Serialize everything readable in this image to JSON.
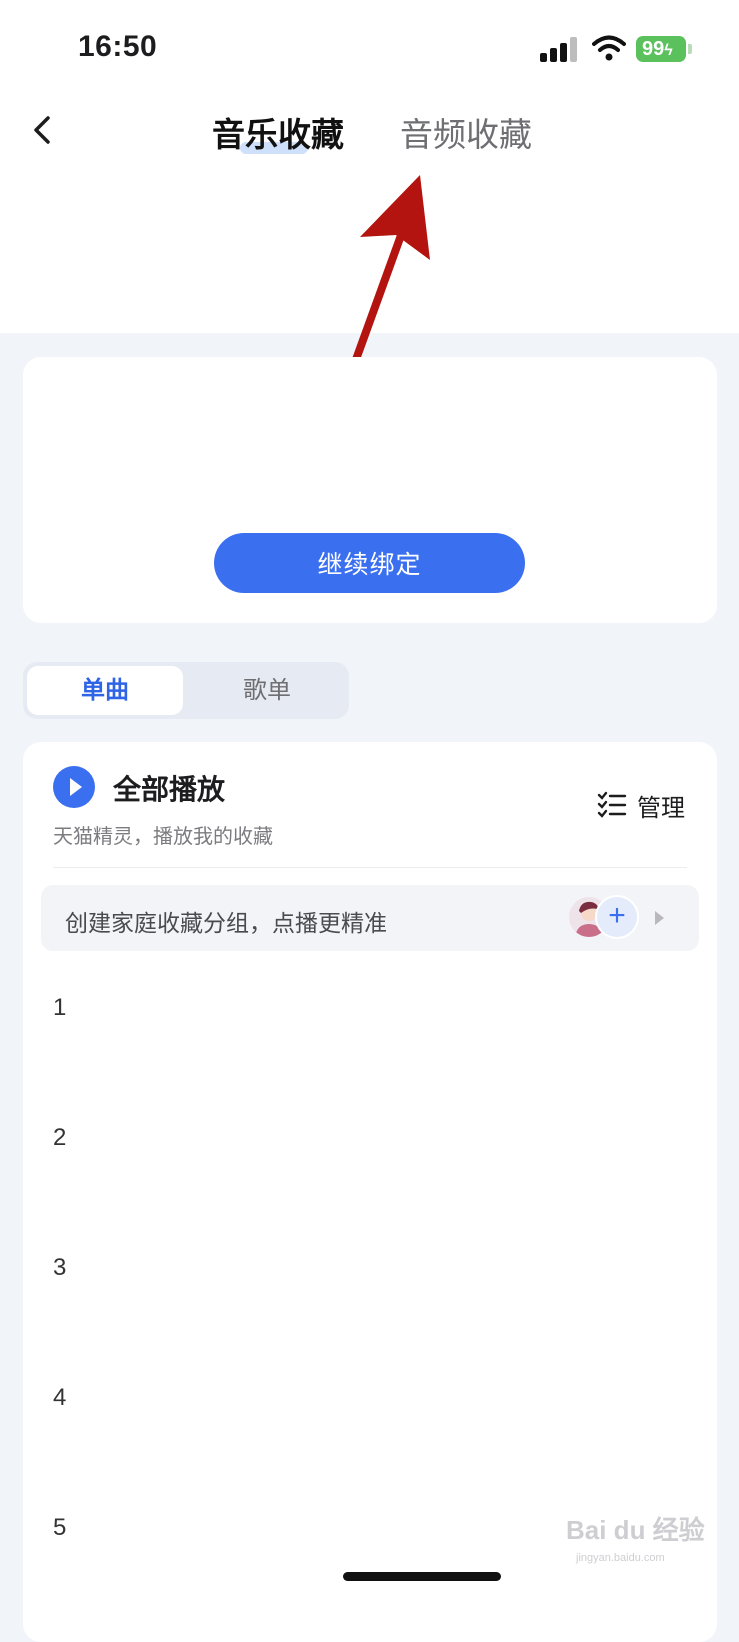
{
  "status_bar": {
    "time": "16:50",
    "battery": "99"
  },
  "nav": {
    "tabs": [
      {
        "label": "音乐收藏",
        "active": true
      },
      {
        "label": "音频收藏",
        "active": false
      }
    ]
  },
  "bind_card": {
    "button_label": "继续绑定"
  },
  "segment": {
    "items": [
      "单曲",
      "歌单"
    ],
    "selected": "单曲"
  },
  "list": {
    "play_all_label": "全部播放",
    "play_all_subtitle": "天猫精灵，播放我的收藏",
    "manage_label": "管理",
    "group_banner_text": "创建家庭收藏分组，点播更精准",
    "rows": [
      "1",
      "2",
      "3",
      "4",
      "5"
    ]
  },
  "watermark": {
    "brand": "Bai du 经验",
    "sub": "jingyan.baidu.com"
  },
  "colors": {
    "accent": "#3a6ff0",
    "background": "#f1f4f9",
    "arrow": "#b3140f",
    "battery": "#5ac15c"
  }
}
